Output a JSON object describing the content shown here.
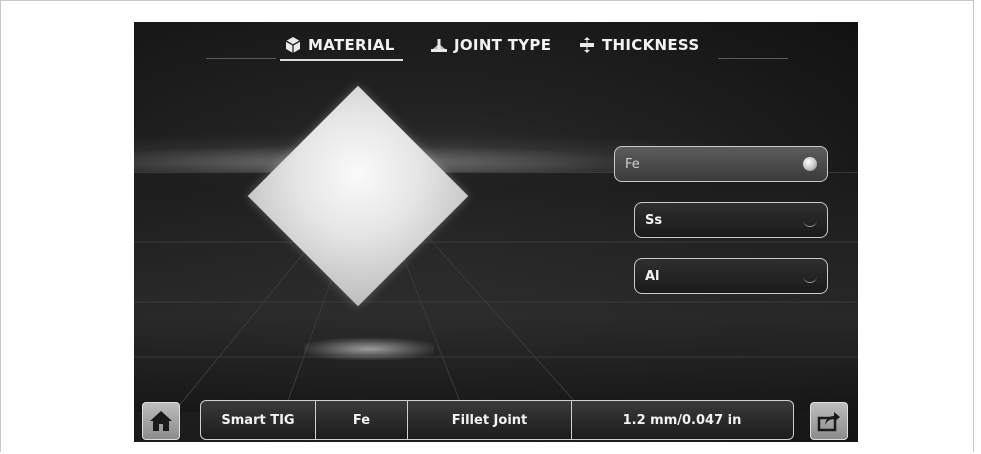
{
  "tabs": [
    {
      "label": "MATERIAL",
      "icon": "cube-icon",
      "active": true
    },
    {
      "label": "JOINT TYPE",
      "icon": "joint-icon",
      "active": false
    },
    {
      "label": "THICKNESS",
      "icon": "thickness-icon",
      "active": false
    }
  ],
  "materials": [
    {
      "label": "Fe",
      "selected": true
    },
    {
      "label": "Ss",
      "selected": false
    },
    {
      "label": "Al",
      "selected": false
    }
  ],
  "status_bar": {
    "process": "Smart TIG",
    "material": "Fe",
    "joint": "Fillet Joint",
    "thickness": "1.2 mm/0.047 in"
  },
  "icons": {
    "home": "home-icon",
    "export": "export-icon"
  }
}
